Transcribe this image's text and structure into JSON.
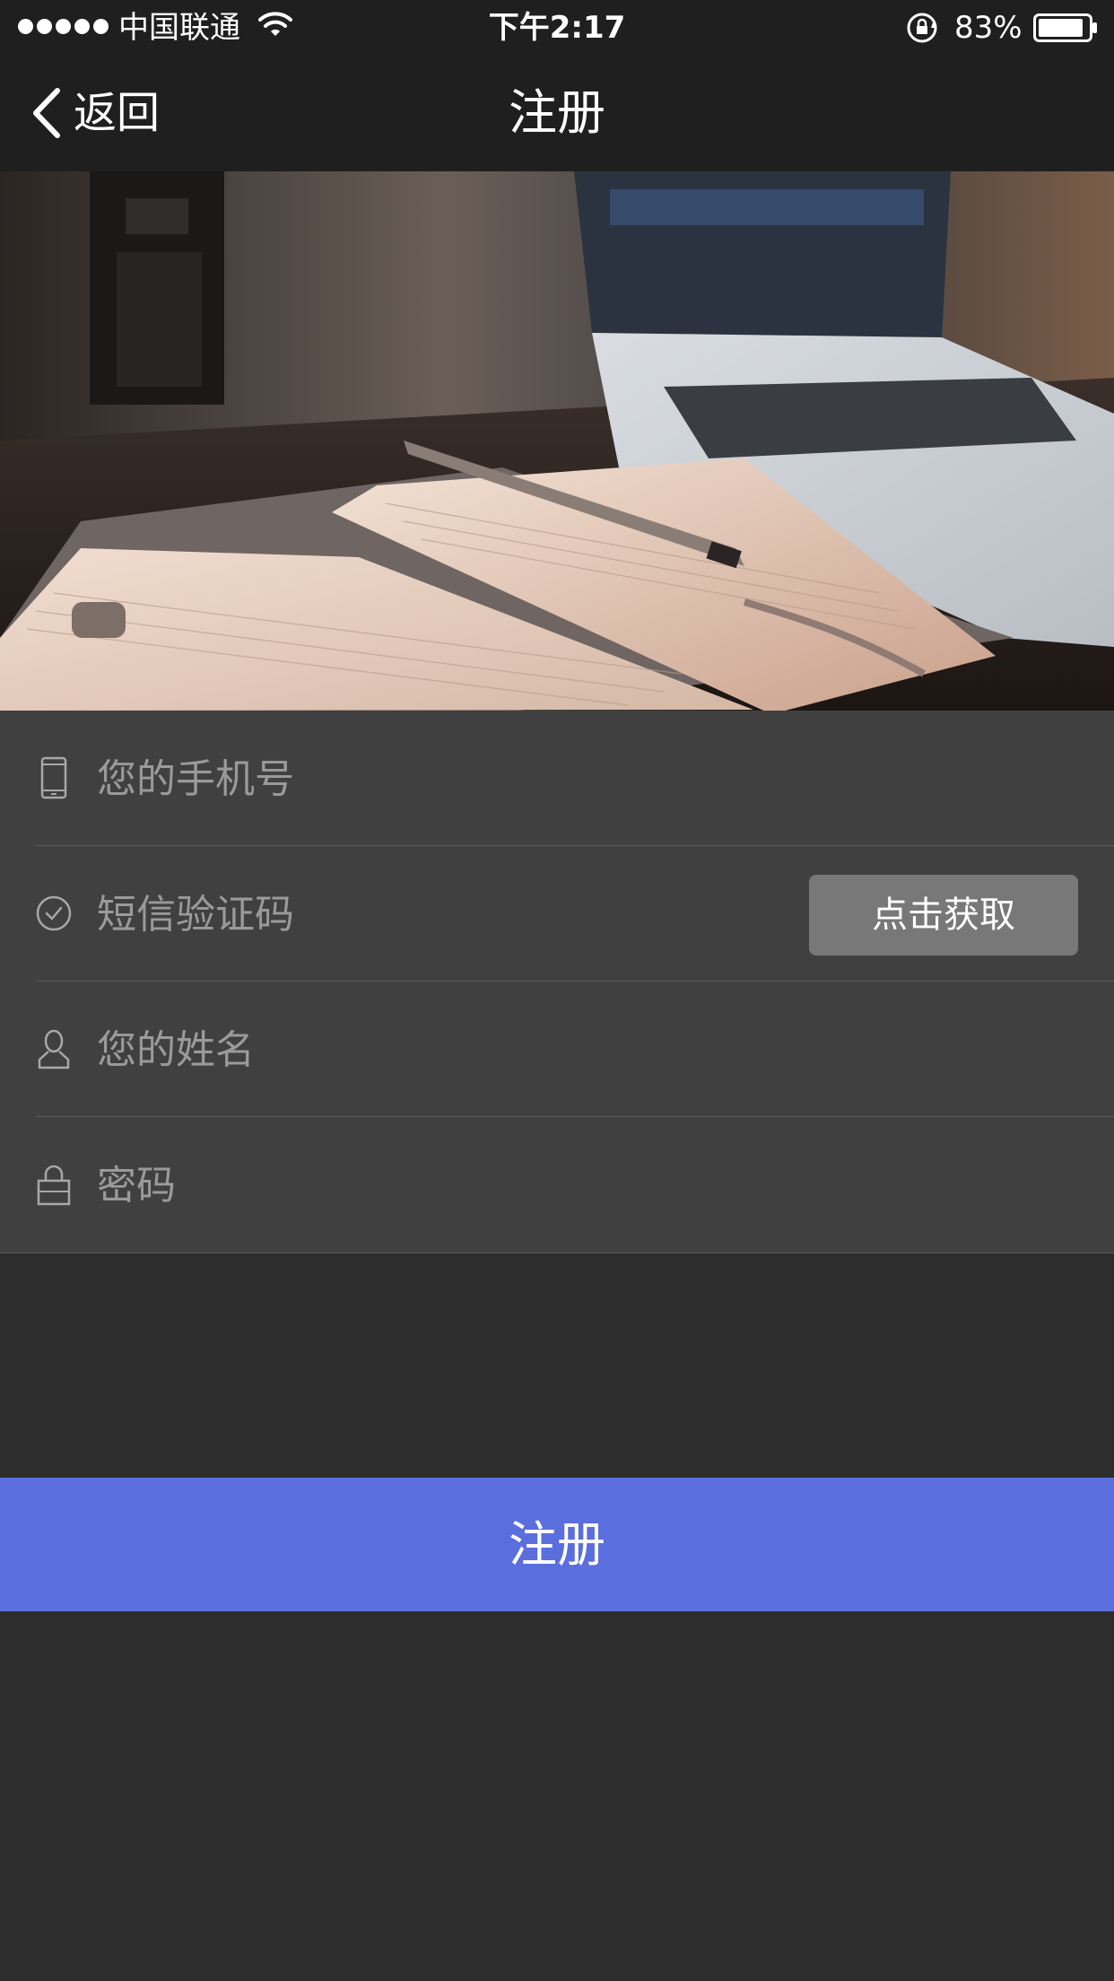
{
  "status_bar": {
    "carrier": "中国联通",
    "time": "下午2:17",
    "battery": "83%"
  },
  "nav": {
    "back_label": "返回",
    "title": "注册"
  },
  "form": {
    "phone_placeholder": "您的手机号",
    "sms_code_placeholder": "短信验证码",
    "get_code_label": "点击获取",
    "name_placeholder": "您的姓名",
    "password_placeholder": "密码"
  },
  "register_label": "注册",
  "colors": {
    "background": "#2d2d2d",
    "bar": "#1f1f1f",
    "form_background": "#404040",
    "get_code_button": "#787878",
    "accent": "#5b6ede"
  },
  "icons": {
    "phone": "mobile-phone-icon",
    "sms": "check-circle-icon",
    "name": "person-icon",
    "password": "lock-icon",
    "back": "chevron-left-icon"
  }
}
